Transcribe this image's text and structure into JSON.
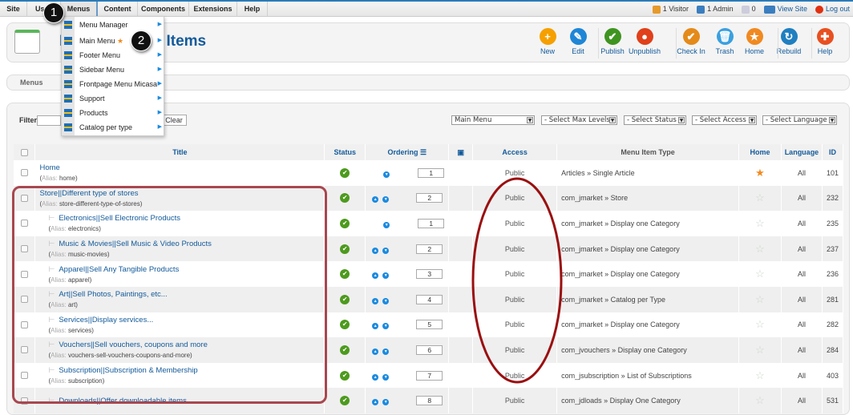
{
  "topnav": {
    "tabs": [
      "Site",
      "Users",
      "Menus",
      "Content",
      "Components",
      "Extensions",
      "Help"
    ],
    "status": {
      "visitors": "1 Visitor",
      "admins": "1 Admin",
      "messages": "0",
      "view_site": "View Site",
      "logout": "Log out"
    }
  },
  "header": {
    "title": "Menus: Menu Items",
    "title_visible_left": "Me",
    "title_visible_right": "enu Items"
  },
  "toolbar": [
    "New",
    "Edit",
    "Publish",
    "Unpublish",
    "Check In",
    "Trash",
    "Home",
    "Rebuild",
    "Help"
  ],
  "toolbar_colors": [
    "#f5a000",
    "#1f86d6",
    "#3f9420",
    "#e0401a",
    "#e48a1a",
    "#3aa0e0",
    "#f08a20",
    "#1f7fc0",
    "#e85020"
  ],
  "submenu": {
    "items": [
      "Menus"
    ]
  },
  "filter": {
    "label": "Filter:",
    "value": "",
    "clear": "Clear",
    "menu": "Main Menu",
    "max_levels": "- Select Max Levels -",
    "status": "- Select Status -",
    "access": "- Select Access -",
    "language": "- Select Language -"
  },
  "dropdown": {
    "items": [
      "Menu Manager",
      "Main Menu",
      "Footer Menu",
      "Sidebar Menu",
      "Frontpage Menu Micasa",
      "Support",
      "Products",
      "Catalog per type"
    ]
  },
  "callouts": [
    "1",
    "2"
  ],
  "table": {
    "columns": [
      "Title",
      "Status",
      "Ordering",
      "Access",
      "Menu Item Type",
      "Home",
      "Language",
      "ID"
    ],
    "alias_label": "Alias:",
    "rows": [
      {
        "title": "Home",
        "alias": "home",
        "level": 1,
        "order": "1",
        "up": false,
        "access": "Public",
        "type": "Articles » Single Article",
        "home": true,
        "lang": "All",
        "id": "101"
      },
      {
        "title": "Store||Different type of stores",
        "alias": "store-different-type-of-stores",
        "level": 1,
        "order": "2",
        "up": true,
        "access": "Public",
        "type": "com_jmarket » Store",
        "home": false,
        "lang": "All",
        "id": "232"
      },
      {
        "title": "Electronics||Sell Electronic Products",
        "alias": "electronics",
        "level": 2,
        "order": "1",
        "up": false,
        "access": "Public",
        "type": "com_jmarket » Display one Category",
        "home": false,
        "lang": "All",
        "id": "235"
      },
      {
        "title": "Music & Movies||Sell Music & Video Products",
        "alias": "music-movies",
        "level": 2,
        "order": "2",
        "up": true,
        "access": "Public",
        "type": "com_jmarket » Display one Category",
        "home": false,
        "lang": "All",
        "id": "237"
      },
      {
        "title": "Apparel||Sell Any Tangible Products",
        "alias": "apparel",
        "level": 2,
        "order": "3",
        "up": true,
        "access": "Public",
        "type": "com_jmarket » Display one Category",
        "home": false,
        "lang": "All",
        "id": "236"
      },
      {
        "title": "Art||Sell Photos, Paintings, etc...",
        "alias": "art",
        "level": 2,
        "order": "4",
        "up": true,
        "access": "Public",
        "type": "com_jmarket » Catalog per Type",
        "home": false,
        "lang": "All",
        "id": "281"
      },
      {
        "title": "Services||Display services...",
        "alias": "services",
        "level": 2,
        "order": "5",
        "up": true,
        "access": "Public",
        "type": "com_jmarket » Display one Category",
        "home": false,
        "lang": "All",
        "id": "282"
      },
      {
        "title": "Vouchers||Sell vouchers, coupons and more",
        "alias": "vouchers-sell-vouchers-coupons-and-more",
        "level": 2,
        "order": "6",
        "up": true,
        "access": "Public",
        "type": "com_jvouchers » Display one Category",
        "home": false,
        "lang": "All",
        "id": "284"
      },
      {
        "title": "Subscription||Subscription & Membership",
        "alias": "subscription",
        "level": 2,
        "order": "7",
        "up": true,
        "access": "Public",
        "type": "com_jsubscription » List of Subscriptions",
        "home": false,
        "lang": "All",
        "id": "403"
      },
      {
        "title": "Downloads||Offer downloadable items",
        "alias": "",
        "level": 2,
        "order": "8",
        "up": true,
        "access": "Public",
        "type": "com_jdloads » Display One Category",
        "home": false,
        "lang": "All",
        "id": "531"
      }
    ]
  },
  "colors": {
    "accent": "#135a9a",
    "annotation": "#a8474f",
    "ellipse": "#9a0f10"
  }
}
